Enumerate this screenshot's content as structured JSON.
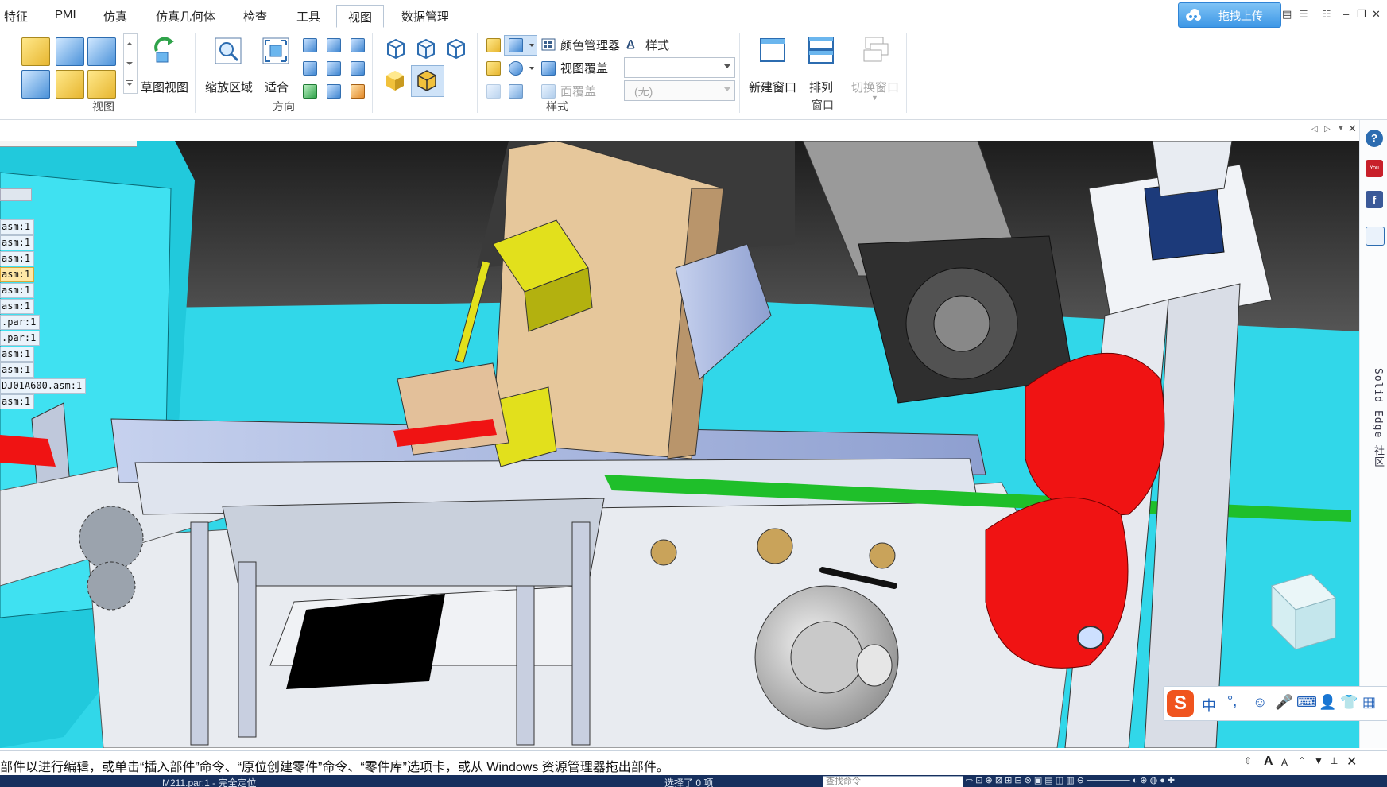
{
  "tabs": [
    {
      "label": "特征",
      "active": false
    },
    {
      "label": "PMI",
      "active": false
    },
    {
      "label": "仿真",
      "active": false
    },
    {
      "label": "仿真几何体",
      "active": false
    },
    {
      "label": "检查",
      "active": false
    },
    {
      "label": "工具",
      "active": false
    },
    {
      "label": "视图",
      "active": true
    },
    {
      "label": "数据管理",
      "active": false
    }
  ],
  "upload": {
    "label": "拖拽上传"
  },
  "ribbon": {
    "view_group": {
      "label": "视图",
      "sketch_view": "草图视图"
    },
    "orient_group": {
      "label": "方向",
      "zoom_area": "缩放区域",
      "fit": "适合"
    },
    "style_group": {
      "label": "样式",
      "color_manager": "颜色管理器",
      "style": "样式",
      "view_override": "视图覆盖",
      "face_override": "面覆盖",
      "combo2_value": "(无)"
    },
    "window_group": {
      "label": "窗口",
      "new_window": "新建窗口",
      "arrange": "排列",
      "switch_window": "切换窗口"
    }
  },
  "tree": {
    "items": [
      {
        "label": "asm:1",
        "selected": false
      },
      {
        "label": "asm:1",
        "selected": false
      },
      {
        "label": "asm:1",
        "selected": false
      },
      {
        "label": "asm:1",
        "selected": true
      },
      {
        "label": "asm:1",
        "selected": false
      },
      {
        "label": "asm:1",
        "selected": false
      },
      {
        "label": ".par:1",
        "selected": false
      },
      {
        "label": ".par:1",
        "selected": false
      },
      {
        "label": "asm:1",
        "selected": false
      },
      {
        "label": "asm:1",
        "selected": false
      },
      {
        "label": "DJ01A600.asm:1",
        "selected": false
      },
      {
        "label": "asm:1",
        "selected": false
      }
    ]
  },
  "rail": {
    "community_text": "Solid Edge 社区"
  },
  "ime": {
    "mode": "中",
    "punct": "°,"
  },
  "prompt": {
    "text": "部件以进行编辑，或单击“插入部件”命令、“原位创建零件”命令、“零件库”选项卡，或从 Windows 资源管理器拖出部件。"
  },
  "status": {
    "part": "M211.par:1 - 完全定位",
    "selection": "选择了 0 项",
    "search_placeholder": "查找命令"
  },
  "colors": {
    "viewport_floor": "#31d7e9",
    "accent": "#3d97e6",
    "status_bar": "#17305e"
  }
}
